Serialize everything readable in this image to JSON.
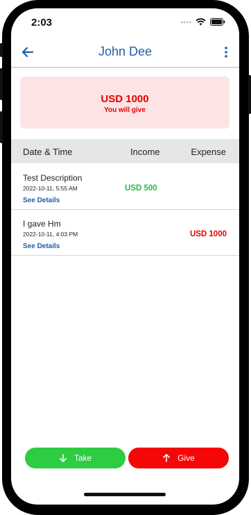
{
  "status": {
    "time": "2:03"
  },
  "header": {
    "title": "John Dee"
  },
  "summary": {
    "amount": "USD 1000",
    "note": "You will give"
  },
  "table": {
    "columns": [
      "Date & Time",
      "Income",
      "Expense"
    ],
    "rows": [
      {
        "description": "Test Description",
        "datetime": "2022-10-11, 5:55 AM",
        "details": "See Details",
        "income": "USD 500",
        "expense": ""
      },
      {
        "description": "I gave Hm",
        "datetime": "2022-10-11, 4:03 PM",
        "details": "See Details",
        "income": "",
        "expense": "USD 1000"
      }
    ]
  },
  "actions": {
    "take": "Take",
    "give": "Give"
  },
  "colors": {
    "accent": "#1f5fa8",
    "income": "#2db83d",
    "expense": "#e60000",
    "take_button": "#2ecc40",
    "give_button": "#f50707",
    "summary_bg": "#fde4e4"
  }
}
